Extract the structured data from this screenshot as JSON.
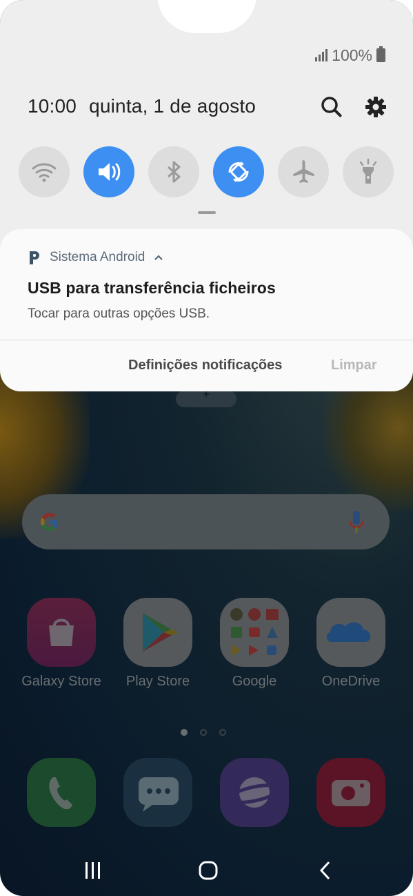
{
  "status_bar": {
    "battery": "100%"
  },
  "header": {
    "time": "10:00",
    "date": "quinta, 1 de agosto"
  },
  "tiles": [
    {
      "name": "wifi",
      "on": false
    },
    {
      "name": "sound",
      "on": true
    },
    {
      "name": "bluetooth",
      "on": false
    },
    {
      "name": "auto-rotate",
      "on": true
    },
    {
      "name": "airplane",
      "on": false
    },
    {
      "name": "flashlight",
      "on": false
    }
  ],
  "notification": {
    "app_name": "Sistema Android",
    "title": "USB para transferência ficheiros",
    "text": "Tocar para outras opções USB.",
    "actions": {
      "settings": "Definições notificações",
      "clear": "Limpar"
    }
  },
  "home": {
    "apps": [
      {
        "label": "Galaxy Store"
      },
      {
        "label": "Play Store"
      },
      {
        "label": "Google"
      },
      {
        "label": "OneDrive"
      }
    ],
    "dock": [
      {
        "name": "phone"
      },
      {
        "name": "messages"
      },
      {
        "name": "internet"
      },
      {
        "name": "camera"
      }
    ]
  },
  "colors": {
    "accent": "#3d8ff2",
    "panel": "#eeeeee",
    "card": "#fafafa"
  },
  "icons": [
    "search-icon",
    "settings-gear-icon",
    "wifi-icon",
    "volume-icon",
    "bluetooth-icon",
    "rotate-icon",
    "airplane-icon",
    "flashlight-icon",
    "android-system-icon",
    "chevron-up-icon",
    "google-icon",
    "mic-icon",
    "recents-icon",
    "home-icon",
    "back-icon"
  ]
}
